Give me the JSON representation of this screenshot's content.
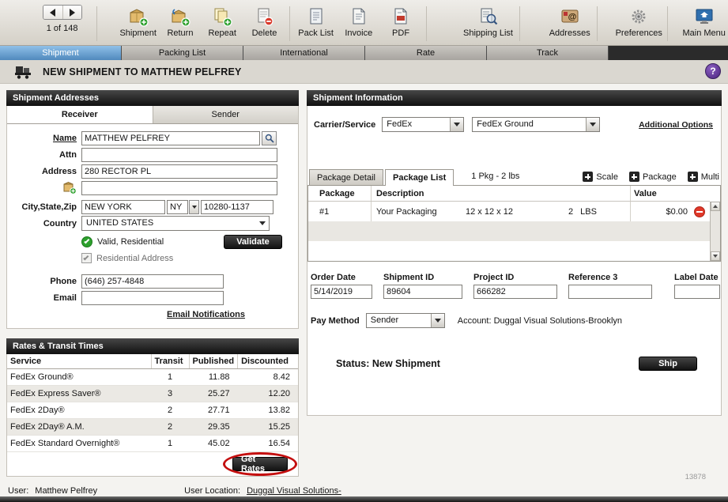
{
  "toolbar": {
    "pager": {
      "counter": "1 of 148"
    },
    "items": [
      {
        "label": "Shipment"
      },
      {
        "label": "Return"
      },
      {
        "label": "Repeat"
      },
      {
        "label": "Delete"
      },
      {
        "label": "Pack List"
      },
      {
        "label": "Invoice"
      },
      {
        "label": "PDF"
      },
      {
        "label": "Shipping List"
      },
      {
        "label": "Addresses"
      },
      {
        "label": "Preferences"
      },
      {
        "label": "Main Menu"
      }
    ]
  },
  "nav_tabs": [
    {
      "label": "Shipment"
    },
    {
      "label": "Packing List"
    },
    {
      "label": "International"
    },
    {
      "label": "Rate"
    },
    {
      "label": "Track"
    }
  ],
  "header": {
    "title": "NEW SHIPMENT TO MATTHEW PELFREY",
    "help_glyph": "?"
  },
  "addresses": {
    "panel_title": "Shipment Addresses",
    "receiver_tab": "Receiver",
    "sender_tab": "Sender",
    "name_label": "Name",
    "name_value": "MATTHEW PELFREY",
    "attn_label": "Attn",
    "attn_value": "",
    "address_label": "Address",
    "address_value": "280 RECTOR PL",
    "address2_value": "",
    "city_state_zip_label": "City,State,Zip",
    "city_value": "NEW YORK",
    "state_value": "NY",
    "zip_value": "10280-1137",
    "country_label": "Country",
    "country_value": "UNITED STATES",
    "validation_status": "Valid, Residential",
    "validate_button": "Validate",
    "residential_label": "Residential Address",
    "phone_label": "Phone",
    "phone_value": "(646) 257-4848",
    "email_label": "Email",
    "email_value": "",
    "email_notifications_link": "Email Notifications"
  },
  "rates": {
    "panel_title": "Rates & Transit Times",
    "columns": {
      "service": "Service",
      "transit": "Transit",
      "published": "Published",
      "discounted": "Discounted"
    },
    "rows": [
      {
        "service": "FedEx Ground®",
        "transit": "1",
        "published": "11.88",
        "discounted": "8.42"
      },
      {
        "service": "FedEx Express Saver®",
        "transit": "3",
        "published": "25.27",
        "discounted": "12.20"
      },
      {
        "service": "FedEx 2Day®",
        "transit": "2",
        "published": "27.71",
        "discounted": "13.82"
      },
      {
        "service": "FedEx 2Day® A.M.",
        "transit": "2",
        "published": "29.35",
        "discounted": "15.25"
      },
      {
        "service": "FedEx Standard Overnight®",
        "transit": "1",
        "published": "45.02",
        "discounted": "16.54"
      }
    ],
    "get_rates_button": "Get Rates"
  },
  "shipment_info": {
    "panel_title": "Shipment Information",
    "carrier_label": "Carrier/Service",
    "carrier_value": "FedEx",
    "service_value": "FedEx Ground",
    "additional_options_link": "Additional Options",
    "package_detail_tab": "Package Detail",
    "package_list_tab": "Package List",
    "package_summary": "1 Pkg - 2 lbs",
    "scale_action": "Scale",
    "package_action": "Package",
    "multi_action": "Multi",
    "table": {
      "package_col": "Package",
      "description_col": "Description",
      "value_col": "Value",
      "row": {
        "package": "#1",
        "description": "Your Packaging",
        "dimensions": "12 x 12 x 12",
        "weight": "2",
        "weight_unit": "LBS",
        "value": "$0.00"
      }
    },
    "order_date_label": "Order Date",
    "order_date_value": "5/14/2019",
    "shipment_id_label": "Shipment ID",
    "shipment_id_value": "89604",
    "project_id_label": "Project ID",
    "project_id_value": "666282",
    "reference3_label": "Reference 3",
    "reference3_value": "",
    "label_date_label": "Label Date",
    "label_date_value": "",
    "pay_method_label": "Pay Method",
    "pay_method_value": "Sender",
    "account_text": "Account: Duggal Visual Solutions-Brooklyn",
    "status_text": "Status: New Shipment",
    "ship_button": "Ship"
  },
  "statusbar": {
    "user_label": "User:",
    "user_value": "Matthew Pelfrey",
    "location_label": "User Location:",
    "location_value": "Duggal Visual Solutions-",
    "code": "13878"
  }
}
